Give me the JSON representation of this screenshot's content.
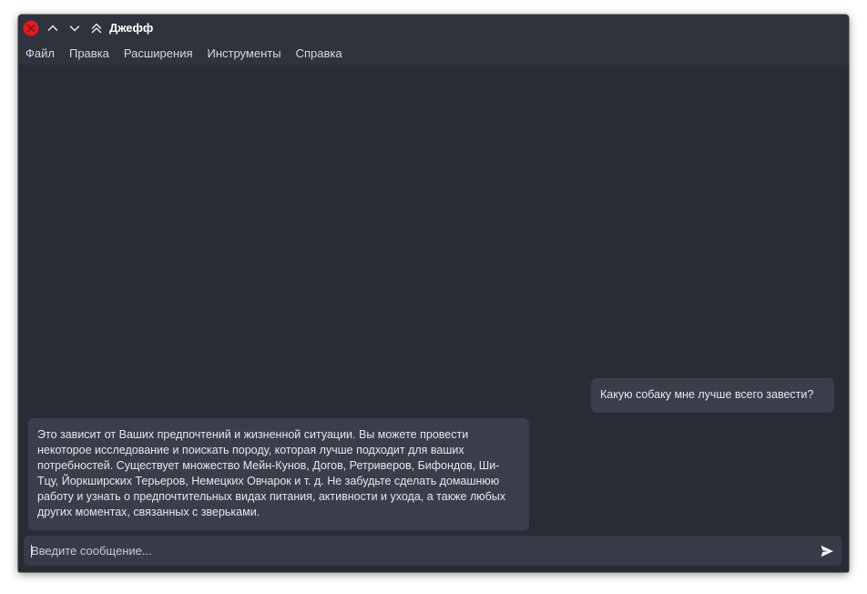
{
  "window": {
    "title": "Джефф"
  },
  "menu": {
    "items": [
      {
        "label": "Файл"
      },
      {
        "label": "Правка"
      },
      {
        "label": "Расширения"
      },
      {
        "label": "Инструменты"
      },
      {
        "label": "Справка"
      }
    ]
  },
  "chat": {
    "messages": [
      {
        "role": "user",
        "text": "Какую собаку мне лучше всего завести?"
      },
      {
        "role": "assistant",
        "text": "Это зависит от Ваших предпочтений и жизненной ситуации. Вы можете провести некоторое исследование и поискать породу, которая лучше подходит для ваших потребностей. Существует множество Мейн-Кунов, Догов, Ретриверов, Бифондов, Ши-Тцу, Йоркширских Терьеров, Немецких Овчарок и т. д. Не забудьте сделать домашнюю работу и узнать о предпочтительных видах питания, активности и ухода, а также любых других моментах, связанных с зверьками."
      }
    ]
  },
  "input": {
    "placeholder": "Введите сообщение...",
    "value": ""
  },
  "icons": {
    "close": "close-icon",
    "minimize": "chevron-up-icon",
    "maximize": "chevron-down-icon",
    "shade": "double-chevron-up-icon",
    "send": "send-icon"
  },
  "colors": {
    "close_button": "#e01b24",
    "background": "#282c34",
    "bubble": "#3a3e4a",
    "titlebar": "#2f333d"
  }
}
